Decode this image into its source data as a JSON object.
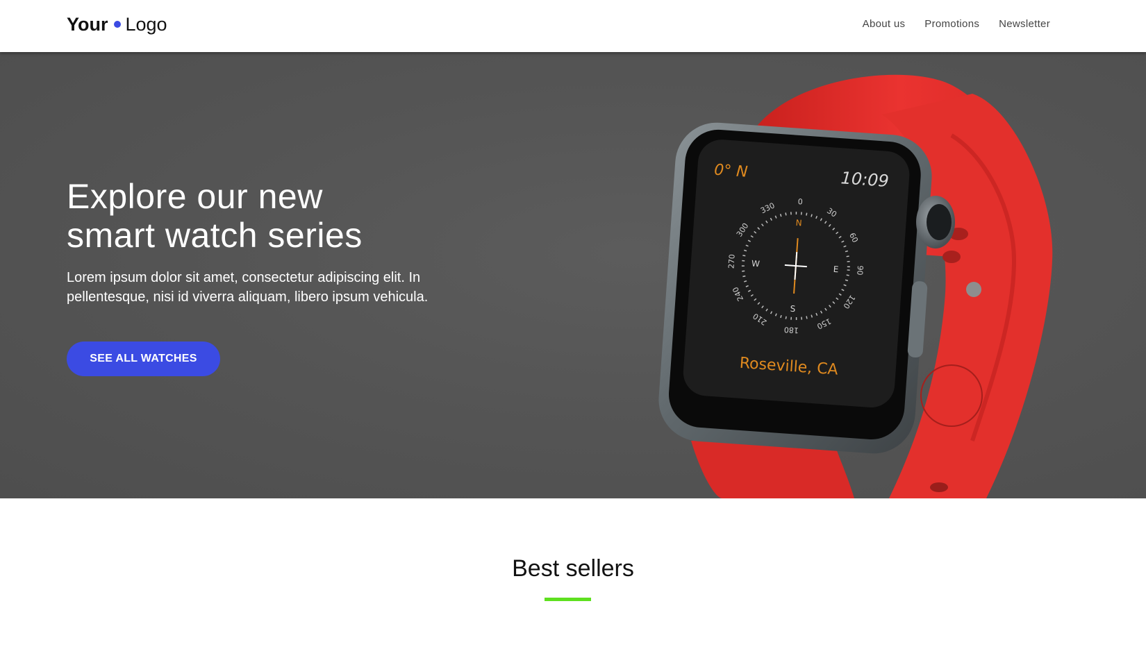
{
  "header": {
    "logo_bold": "Your",
    "logo_light": "Logo",
    "nav": [
      "About us",
      "Promotions",
      "Newsletter"
    ]
  },
  "hero": {
    "title_line1": "Explore our new",
    "title_line2": "smart watch series",
    "text": "Lorem ipsum dolor sit amet, consectetur adipiscing elit. In pellentesque, nisi id viverra aliquam, libero ipsum vehicula.",
    "cta_label": "SEE ALL WATCHES"
  },
  "watch": {
    "heading": "0° N",
    "time": "10:09",
    "location": "Roseville, CA",
    "compass_numbers": [
      "0",
      "30",
      "60",
      "90",
      "120",
      "150",
      "180",
      "210",
      "240",
      "270",
      "300",
      "330"
    ],
    "cardinals": [
      "N",
      "E",
      "S",
      "W"
    ]
  },
  "best_sellers": {
    "title": "Best sellers"
  },
  "colors": {
    "accent": "#3b4be3",
    "underline": "#5ee01f",
    "hero_bg": "#555555",
    "band": "#e8302b",
    "compass_orange": "#e08a1f"
  }
}
